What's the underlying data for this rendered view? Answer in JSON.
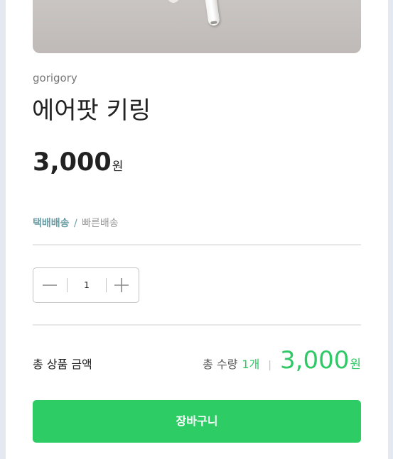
{
  "product": {
    "brand": "gorigory",
    "name": "에어팟 키링",
    "price": "3,000",
    "price_unit": "원",
    "image_icon": "product-photo"
  },
  "delivery": {
    "method": "택배배송",
    "separator": "/",
    "option": "빠른배송"
  },
  "quantity": {
    "value": "1",
    "minus_icon": "minus-icon",
    "plus_icon": "plus-icon"
  },
  "total": {
    "label": "총 상품 금액",
    "qty_label": "총 수량",
    "qty_value": "1개",
    "separator": "|",
    "amount": "3,000",
    "unit": "원"
  },
  "cart": {
    "button_label": "장바구니"
  },
  "colors": {
    "accent": "#2dcc64",
    "delivery": "#6b9da5"
  }
}
